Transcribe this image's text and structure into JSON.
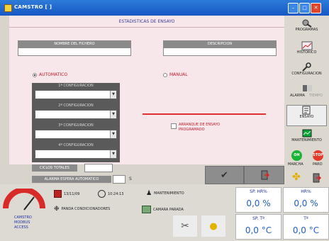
{
  "window": {
    "title": "CAMSTRO [ ]"
  },
  "main": {
    "section_title": "ESTADISTICAS DE ENSAYO",
    "file_name_label": "NOMBRE DEL FICHERO",
    "file_name_value": "",
    "description_label": "DESCRIPCION",
    "description_value": "",
    "mode_auto_label": "AUTOMATICO",
    "mode_manual_label": "MANUAL",
    "config_labels": [
      "1ª CONFIGURACION",
      "2ª CONFIGURACION",
      "3ª CONFIGURACION",
      "4ª CONFIGURACION"
    ],
    "cycles_label": "CICLOS TOTALES",
    "cycles_value": "",
    "alarm_label": "ALARMA ESPERA AUTOMATICO",
    "alarm_value": "",
    "alarm_unit": "S",
    "programmed_start_label": "ARRANQUE DE ENSAYO PROGRAMADO"
  },
  "actions": {
    "accept_icon": "checkmark-icon",
    "exit_icon": "exit-door-icon"
  },
  "sidebar": {
    "items": [
      {
        "label": "PROGRAMAS",
        "icon": "program-icon"
      },
      {
        "label": "HISTORICO",
        "icon": "history-icon"
      },
      {
        "label": "CONFIGURACION",
        "icon": "configuration-icon"
      },
      {
        "label": "ENSAYO",
        "icon": "test-icon"
      },
      {
        "label": "MANTENIMIENTO",
        "icon": "maintenance-icon"
      }
    ],
    "small_left_label": "ALARMA",
    "small_right_label": "TIEMPO",
    "start_label": "MARCHA",
    "start_badge": "ON",
    "stop_label": "PARO",
    "stop_badge": "STOP"
  },
  "status": {
    "date": "13/11/09",
    "time": "10:24:13",
    "maintenance_label": "MANTENIMIENTO",
    "fan_label": "PANDA CONDICIONADORES",
    "camera_label": "CAMARA PARADA",
    "brand_lines": [
      "CAMSTRO",
      "MODBUS",
      "ACCESS"
    ],
    "readouts": [
      {
        "label": "SP. HR%",
        "value": "0,0 %"
      },
      {
        "label": "HR%",
        "value": "0,0 %"
      },
      {
        "label": "SP. Tª",
        "value": "0,0 °C"
      },
      {
        "label": "Tª",
        "value": "0,0 °C"
      }
    ]
  },
  "colors": {
    "title_bar": "#1757c5",
    "form_bg": "#f7e6ea",
    "accent_red": "#e03030",
    "label_blue": "#1f5fc8"
  }
}
